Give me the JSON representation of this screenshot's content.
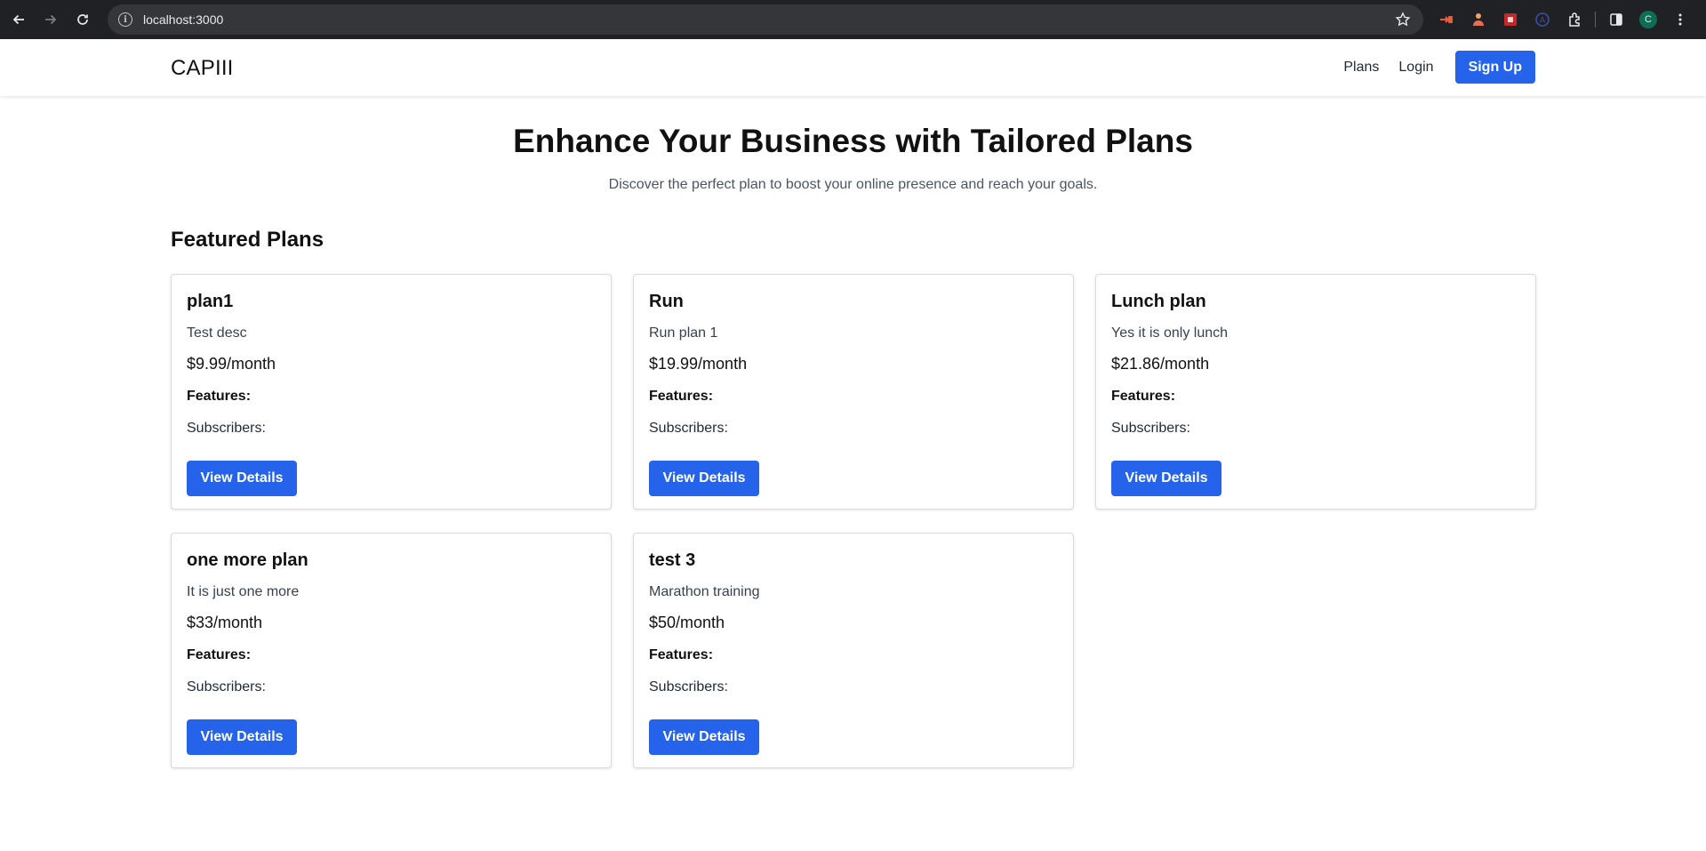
{
  "browser": {
    "url": "localhost:3000",
    "icons": [
      "back-icon",
      "forward-icon",
      "reload-icon",
      "site-info-icon",
      "bookmark-star-icon",
      "extensions-icon",
      "side-panel-icon",
      "more-icon"
    ],
    "profile_initial": "C"
  },
  "header": {
    "brand": "CAPIII",
    "nav": {
      "plans": "Plans",
      "login": "Login",
      "signup": "Sign Up"
    }
  },
  "hero": {
    "title": "Enhance Your Business with Tailored Plans",
    "subtitle": "Discover the perfect plan to boost your online presence and reach your goals."
  },
  "featured": {
    "title": "Featured Plans",
    "plans": [
      {
        "name": "plan1",
        "description": "Test desc",
        "price": "$9.99/month",
        "features_label": "Features:",
        "subscribers_label": "Subscribers:",
        "button": "View Details"
      },
      {
        "name": "Run",
        "description": "Run plan 1",
        "price": "$19.99/month",
        "features_label": "Features:",
        "subscribers_label": "Subscribers:",
        "button": "View Details"
      },
      {
        "name": "Lunch plan",
        "description": "Yes it is only lunch",
        "price": "$21.86/month",
        "features_label": "Features:",
        "subscribers_label": "Subscribers:",
        "button": "View Details"
      },
      {
        "name": "one more plan",
        "description": "It is just one more",
        "price": "$33/month",
        "features_label": "Features:",
        "subscribers_label": "Subscribers:",
        "button": "View Details"
      },
      {
        "name": "test 3",
        "description": "Marathon training",
        "price": "$50/month",
        "features_label": "Features:",
        "subscribers_label": "Subscribers:",
        "button": "View Details"
      }
    ]
  },
  "colors": {
    "accent": "#2563eb",
    "chrome": "#202124",
    "urlbar": "#35363a"
  }
}
